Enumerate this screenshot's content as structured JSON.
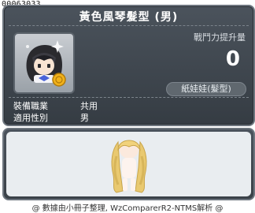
{
  "item": {
    "id_label": "00063033",
    "name": "黃色風琴髮型 (男)",
    "stat_label": "戰鬥力提升量",
    "stat_value": "0",
    "category": "紙娃娃(髮型)"
  },
  "requirements": [
    {
      "label": "裝備職業",
      "value": "共用"
    },
    {
      "label": "適用性別",
      "value": "男"
    }
  ],
  "footer_text": "@ 數據由小冊子整理, WzComparerR2-NTMS解析 @",
  "colors": {
    "panel_bg": "#3c434a",
    "panel_border": "#6c747d",
    "text_primary": "#ffffff",
    "preview_bg": "#e9edf0",
    "hair_color": "#e9c970"
  }
}
